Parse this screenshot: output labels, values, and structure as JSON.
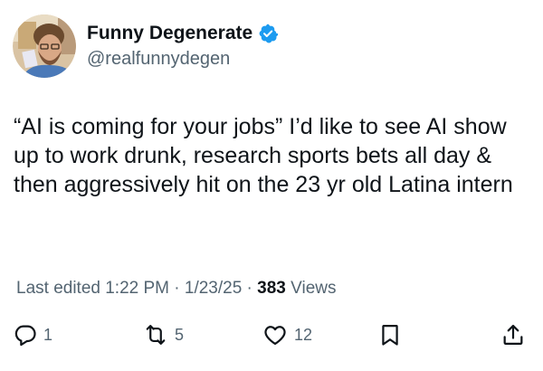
{
  "author": {
    "display_name": "Funny Degenerate",
    "handle": "@realfunnydegen",
    "avatar_icon": "profile-photo",
    "verified_icon": "verified-badge-icon",
    "verified_color": "#1d9bf0"
  },
  "tweet": {
    "text": "“AI is coming for your jobs” I’d like to see AI show up to work drunk, research sports bets all day & then aggressively hit on the 23 yr old Latina intern"
  },
  "meta": {
    "edited_label": "Last edited 1:22 PM · 1/23/25",
    "separator": " · ",
    "views_count": "383",
    "views_label": "Views"
  },
  "actions": {
    "reply": {
      "icon": "reply-icon",
      "count": "1"
    },
    "repost": {
      "icon": "repost-icon",
      "count": "5"
    },
    "like": {
      "icon": "heart-icon",
      "count": "12"
    },
    "bookmark": {
      "icon": "bookmark-icon"
    },
    "share": {
      "icon": "share-icon"
    }
  },
  "colors": {
    "text_primary": "#0f1419",
    "text_secondary": "#536471"
  }
}
